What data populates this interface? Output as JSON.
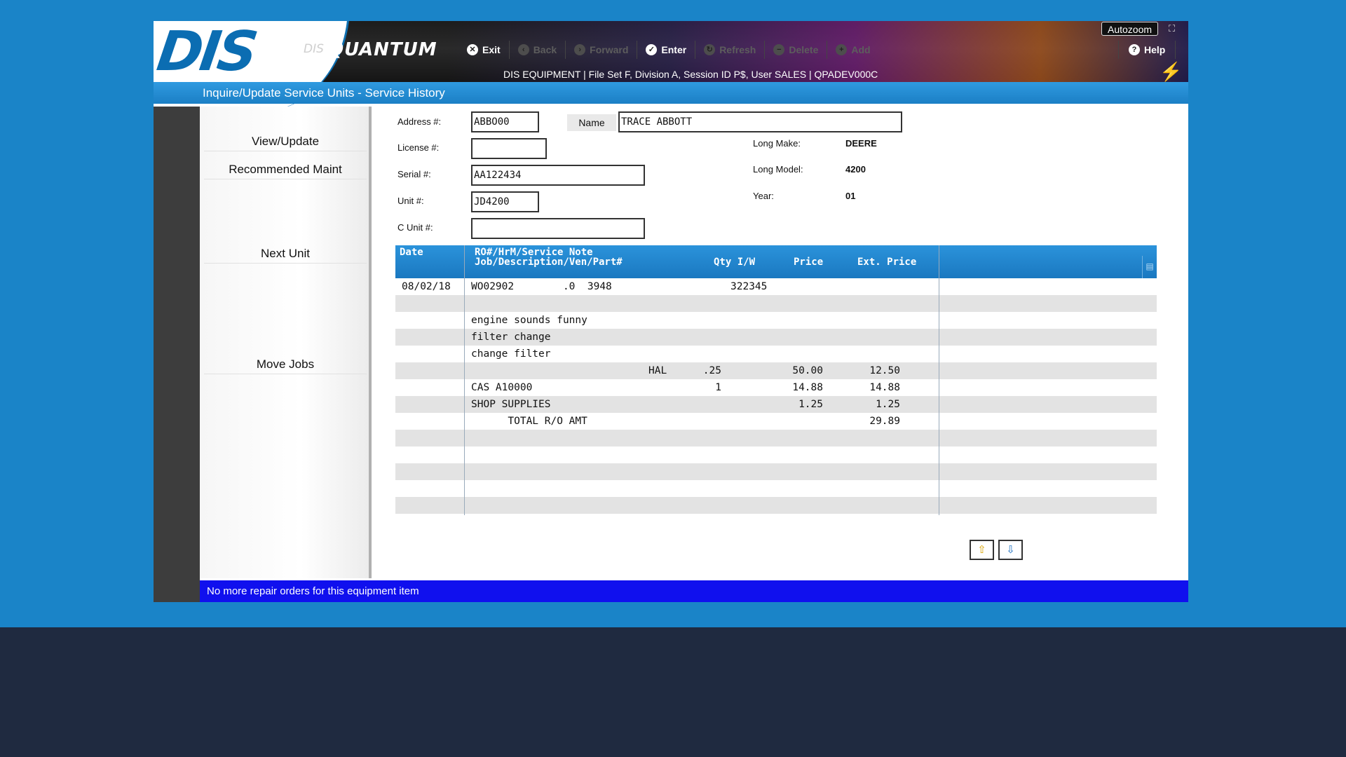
{
  "header": {
    "logo_text": "DIS",
    "brand_prefix": "DIS",
    "brand_name": "QUANTUM",
    "autozoom_label": "Autozoom",
    "session_info": "DIS EQUIPMENT | File Set F, Division A, Session ID P$, User SALES | QPADEV000C",
    "toolbar": [
      {
        "label": "Exit",
        "icon": "close-icon",
        "enabled": true
      },
      {
        "label": "Back",
        "icon": "back-icon",
        "enabled": false
      },
      {
        "label": "Forward",
        "icon": "forward-icon",
        "enabled": false
      },
      {
        "label": "Enter",
        "icon": "check-icon",
        "enabled": true
      },
      {
        "label": "Refresh",
        "icon": "refresh-icon",
        "enabled": false
      },
      {
        "label": "Delete",
        "icon": "delete-icon",
        "enabled": false
      },
      {
        "label": "Add",
        "icon": "add-icon",
        "enabled": false
      }
    ],
    "help_label": "Help"
  },
  "title": "Inquire/Update Service Units - Service History",
  "side_menu": {
    "view_update": "View/Update",
    "recommended_maint": "Recommended Maint",
    "next_unit": "Next Unit",
    "move_jobs": "Move Jobs"
  },
  "form": {
    "address_label": "Address #:",
    "address_value": "ABBO00",
    "name_label": "Name",
    "name_value": "TRACE ABBOTT",
    "license_label": "License #:",
    "license_value": "",
    "serial_label": "Serial #:",
    "serial_value": "AA122434",
    "unit_label": "Unit #:",
    "unit_value": "JD4200",
    "cunit_label": "C Unit #:",
    "cunit_value": "",
    "long_make_label": "Long Make:",
    "long_make_value": "DEERE",
    "long_model_label": "Long Model:",
    "long_model_value": "4200",
    "year_label": "Year:",
    "year_value": "01"
  },
  "grid": {
    "headers": {
      "date": "Date",
      "ro_line1": "RO#/HrM/Service Note",
      "ro_line2": "Job/Description/Ven/Part#",
      "qty": "Qty I/W",
      "price": "Price",
      "ext_price": "Ext. Price"
    },
    "rows": [
      {
        "date": "08/02/18",
        "desc": "WO02902        .0  3948",
        "desc2": "322345",
        "qty": "",
        "price": "",
        "ext": ""
      },
      {
        "date": "",
        "desc": "",
        "desc2": "",
        "qty": "",
        "price": "",
        "ext": ""
      },
      {
        "date": "",
        "desc": "engine sounds funny",
        "desc2": "",
        "qty": "",
        "price": "",
        "ext": ""
      },
      {
        "date": "",
        "desc": "filter change",
        "desc2": "",
        "qty": "",
        "price": "",
        "ext": ""
      },
      {
        "date": "",
        "desc": "change filter",
        "desc2": "",
        "qty": "",
        "price": "",
        "ext": ""
      },
      {
        "date": "",
        "desc": "",
        "desc2": "HAL",
        "qty": ".25",
        "price": "50.00",
        "ext": "12.50"
      },
      {
        "date": "",
        "desc": "CAS A10000",
        "desc2": "",
        "qty": "1",
        "price": "14.88",
        "ext": "14.88"
      },
      {
        "date": "",
        "desc": "SHOP SUPPLIES",
        "desc2": "",
        "qty": "",
        "price": "1.25",
        "ext": "1.25"
      },
      {
        "date": "",
        "desc": "      TOTAL R/O AMT",
        "desc2": "",
        "qty": "",
        "price": "",
        "ext": "29.89"
      },
      {
        "date": "",
        "desc": "",
        "desc2": "",
        "qty": "",
        "price": "",
        "ext": ""
      },
      {
        "date": "",
        "desc": "",
        "desc2": "",
        "qty": "",
        "price": "",
        "ext": ""
      },
      {
        "date": "",
        "desc": "",
        "desc2": "",
        "qty": "",
        "price": "",
        "ext": ""
      },
      {
        "date": "",
        "desc": "",
        "desc2": "",
        "qty": "",
        "price": "",
        "ext": ""
      },
      {
        "date": "",
        "desc": "",
        "desc2": "",
        "qty": "",
        "price": "",
        "ext": ""
      }
    ]
  },
  "status_message": "No more repair orders for this equipment item",
  "colors": {
    "background": "#1a84c8",
    "accent": "#1b7fc5",
    "status_bar": "#1010ee",
    "alt_row": "#e3e3e3"
  }
}
